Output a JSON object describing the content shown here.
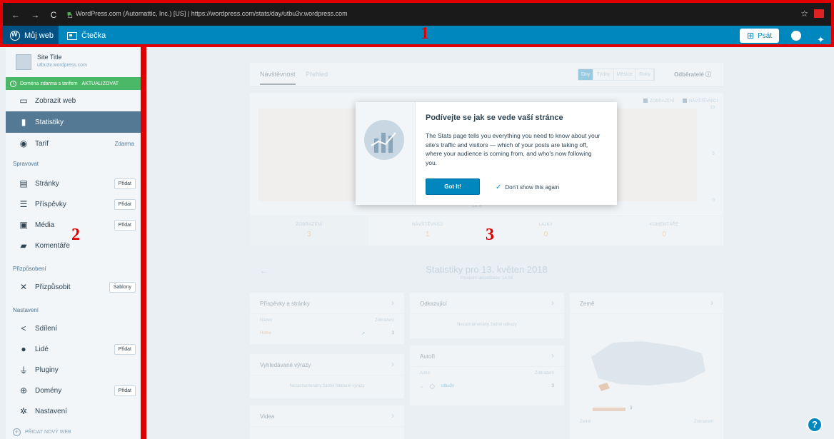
{
  "browser": {
    "nav": "← → C ⌂",
    "url_secure_label": "WordPress.com (Automattic, Inc.) [US]",
    "url": "https://wordpress.com/stats/day/utbu3v.wordpress.com",
    "star_icon": "star-icon"
  },
  "masterbar": {
    "my_site": "Můj web",
    "reader": "Čtečka",
    "write": "Psát"
  },
  "annotations": {
    "one": "1",
    "two": "2",
    "three": "3"
  },
  "sidebar": {
    "site_title": "Site Title",
    "site_url": "utbu3v.wordpress.com",
    "plan_banner": "Doména zdarma s tarifem",
    "plan_upgrade": "AKTUALIZOVAT",
    "view_site": "Zobrazit web",
    "stats": "Statistiky",
    "plan": "Tarif",
    "plan_value": "Zdarma",
    "manage_heading": "Spravovat",
    "pages": "Stránky",
    "posts": "Příspěvky",
    "media": "Média",
    "comments": "Komentáře",
    "add": "Přidat",
    "personalize_heading": "Přizpůsobení",
    "customize": "Přizpůsobit",
    "themes": "Šablony",
    "settings_heading": "Nastavení",
    "sharing": "Sdílení",
    "people": "Lidé",
    "plugins": "Pluginy",
    "domains": "Domény",
    "settings": "Nastavení",
    "add_new_site": "PŘIDAT NOVÝ WEB"
  },
  "stats": {
    "tab_visits": "Návštěvnost",
    "tab_overview": "Přehled",
    "periods": [
      "Dny",
      "Týdny",
      "Měsíce",
      "Roky"
    ],
    "followers": "Odběratelé",
    "legend_views": "ZOBRAZENÍ",
    "legend_visitors": "NÁVŠTĚVNÍCI",
    "summary": [
      {
        "label": "ZOBRAZENÍ",
        "value": "3"
      },
      {
        "label": "NÁVŠTĚVNÍCI",
        "value": "1"
      },
      {
        "label": "LAJKY",
        "value": "0"
      },
      {
        "label": "KOMENTÁŘE",
        "value": "0"
      }
    ],
    "title": "Statistiky pro 13. květen 2018",
    "updated": "Poslední aktualizace: 14:59",
    "posts_pages": "Příspěvky a stránky",
    "col_title": "Název",
    "col_views": "Zobrazení",
    "row_home": "Home",
    "row_home_views": "3",
    "search_terms": "Vyhledávané výrazy",
    "search_empty": "Nezaznamenány žádné hledané výrazy",
    "videos": "Videa",
    "referrers": "Odkazující",
    "referrers_empty": "Nezaznamenány žádné odkazy",
    "authors": "Autoři",
    "col_author": "Autor",
    "author_name": "utbu3v",
    "author_views": "3",
    "countries": "Země",
    "col_country": "Země",
    "country_value": "3"
  },
  "chart_data": {
    "type": "bar",
    "categories": [
      "",
      "",
      "13. 5.",
      "",
      ""
    ],
    "series": [
      {
        "name": "ZOBRAZENÍ",
        "values": [
          0,
          0,
          3,
          0,
          0
        ]
      }
    ],
    "yticks": [
      "10",
      "5",
      "0"
    ],
    "ylim": [
      0,
      10
    ]
  },
  "modal": {
    "title": "Podívejte se jak se vede vaší stránce",
    "body": "The Stats page tells you everything you need to know about your site's traffic and visitors — which of your posts are taking off, where your audience is coming from, and who's now following you.",
    "got_it": "Got It!",
    "dont_show": "Don't show this again"
  },
  "help": "?"
}
